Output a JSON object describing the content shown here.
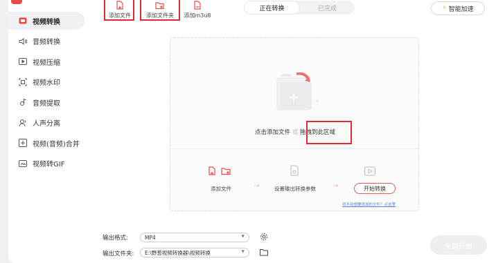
{
  "sidebar": {
    "items": [
      {
        "label": "视频转换",
        "icon": "video-convert-icon",
        "active": true
      },
      {
        "label": "音频转换",
        "icon": "audio-convert-icon"
      },
      {
        "label": "视频压缩",
        "icon": "video-compress-icon"
      },
      {
        "label": "视频水印",
        "icon": "video-watermark-icon"
      },
      {
        "label": "音频提取",
        "icon": "audio-extract-icon"
      },
      {
        "label": "人声分离",
        "icon": "voice-separate-icon"
      },
      {
        "label": "视频(音频)合并",
        "icon": "merge-icon"
      },
      {
        "label": "视频转GIF",
        "icon": "gif-icon"
      }
    ]
  },
  "toolbar": {
    "add_file": "添加文件",
    "add_folder": "添加文件夹",
    "add_m3u8": "添加m3u8"
  },
  "tabs": {
    "converting": "正在转换",
    "completed": "已完成"
  },
  "accelerate": "智能加速",
  "dropzone": {
    "text": "点击添加文件",
    "hint": "或",
    "drag_text": "拖拽到此区域",
    "steps": {
      "add_file": "添加文件",
      "settings": "设置输出转换参数",
      "start": "开始转换"
    },
    "help_link": "找不到想要添加的文件？点这里"
  },
  "bottom": {
    "format_label": "输出格式:",
    "format_value": "MP4",
    "folder_label": "输出文件夹:",
    "folder_value": "E:\\野葱视频转换器\\视频转换",
    "start_all": "全部开始"
  },
  "colors": {
    "accent": "#e84a4a",
    "highlight_box": "#e0292f"
  }
}
